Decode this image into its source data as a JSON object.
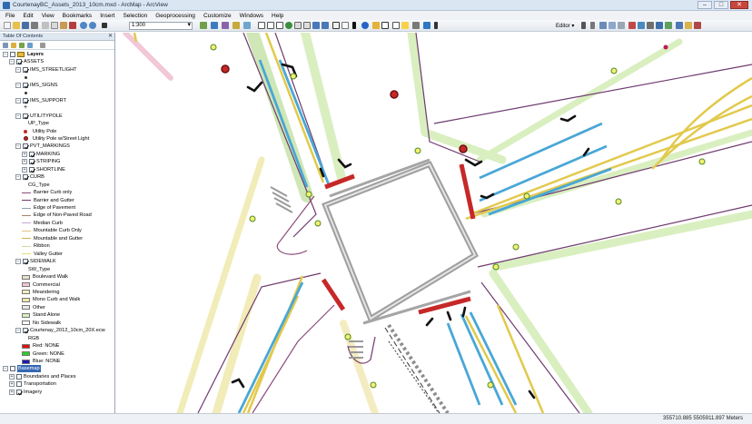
{
  "window": {
    "title": "CourtenayBC_Assets_2013_10cm.mxd - ArcMap - ArcView"
  },
  "menu": [
    "File",
    "Edit",
    "View",
    "Bookmarks",
    "Insert",
    "Selection",
    "Geoprocessing",
    "Customize",
    "Windows",
    "Help"
  ],
  "toolbar": {
    "scale": "1:300",
    "editor_label": "Editor ▾"
  },
  "toc": {
    "title": "Table Of Contents",
    "rows": [
      {
        "label": "Layers",
        "indent": 0,
        "exp": "−",
        "chk": false,
        "sym": "layers",
        "bold": true
      },
      {
        "label": "ASSETS",
        "indent": 1,
        "exp": "−",
        "chk": true
      },
      {
        "label": "IMS_STREETLIGHT",
        "indent": 2,
        "exp": "−",
        "chk": true
      },
      {
        "label": "",
        "indent": 3,
        "sym": "dot"
      },
      {
        "label": "IMS_SIGNS",
        "indent": 2,
        "exp": "−",
        "chk": true
      },
      {
        "label": "",
        "indent": 3,
        "sym": "smalldot"
      },
      {
        "label": "IMS_SUPPORT",
        "indent": 2,
        "exp": "−",
        "chk": true
      },
      {
        "label": "",
        "indent": 3,
        "sym": "plus"
      },
      {
        "label": "UTILITYPOLE",
        "indent": 2,
        "exp": "−",
        "chk": true
      },
      {
        "label": "UP_Type",
        "indent": 4
      },
      {
        "label": "Utility Pole",
        "indent": 3,
        "sym": "reddot"
      },
      {
        "label": "Utility Pole w/Street Light",
        "indent": 3,
        "sym": "redring"
      },
      {
        "label": "PVT_MARKINGS",
        "indent": 2,
        "exp": "−",
        "chk": true
      },
      {
        "label": "MARKING",
        "indent": 3,
        "exp": "+",
        "chk": true
      },
      {
        "label": "STRIPING",
        "indent": 3,
        "exp": "+",
        "chk": true
      },
      {
        "label": "SHORTLINE",
        "indent": 3,
        "exp": "+",
        "chk": true
      },
      {
        "label": "CURB",
        "indent": 2,
        "exp": "−",
        "chk": true
      },
      {
        "label": "CG_Type",
        "indent": 4
      },
      {
        "label": "Barrier Curb only",
        "indent": 3,
        "sym": "line:#8c4b7a"
      },
      {
        "label": "Barrier and Gutter",
        "indent": 3,
        "sym": "line:#6f3a70"
      },
      {
        "label": "Edge of Pavement",
        "indent": 3,
        "sym": "line:#9aa0a6"
      },
      {
        "label": "Edge of Non-Paved Road",
        "indent": 3,
        "sym": "line:#a0866a"
      },
      {
        "label": "Median Curb",
        "indent": 3,
        "sym": "line:#c2a8d8"
      },
      {
        "label": "Mountable Curb Only",
        "indent": 3,
        "sym": "line:#e3c27a"
      },
      {
        "label": "Mountable and Gutter",
        "indent": 3,
        "sym": "line:#d6b24c"
      },
      {
        "label": "Ribbon",
        "indent": 3,
        "sym": "line:#d8d4a4"
      },
      {
        "label": "Valley Gutter",
        "indent": 3,
        "sym": "line:#e4dc7e"
      },
      {
        "label": "SIDEWALK",
        "indent": 2,
        "exp": "−",
        "chk": true
      },
      {
        "label": "SW_Type",
        "indent": 4
      },
      {
        "label": "Boulevard Walk",
        "indent": 3,
        "sym": "box:#e9e3c6"
      },
      {
        "label": "Commercial",
        "indent": 3,
        "sym": "box:#f2c8d6"
      },
      {
        "label": "Meandering",
        "indent": 3,
        "sym": "box:#f4ecc1"
      },
      {
        "label": "Mono Curb and Walk",
        "indent": 3,
        "sym": "box:#efe8a4"
      },
      {
        "label": "Other",
        "indent": 3,
        "sym": "box:#e9e9e9"
      },
      {
        "label": "Stand Alone",
        "indent": 3,
        "sym": "box:#d9efc0"
      },
      {
        "label": "No Sidewalk",
        "indent": 3,
        "sym": "box:#ffffff"
      },
      {
        "label": "Courtenay_2012_10cm_20X.ecw",
        "indent": 2,
        "exp": "−",
        "chk": true
      },
      {
        "label": "RGB",
        "indent": 4
      },
      {
        "label": "Red:    NONE",
        "indent": 3,
        "sym": "box:#e01010"
      },
      {
        "label": "Green: NONE",
        "indent": 3,
        "sym": "box:#2ccd2c"
      },
      {
        "label": "Blue:   NONE",
        "indent": 3,
        "sym": "box:#1a1ab3"
      },
      {
        "label": "Basemap",
        "indent": 0,
        "exp": "−",
        "chk": false,
        "sel": true
      },
      {
        "label": "Boundaries and Places",
        "indent": 1,
        "exp": "+",
        "chk": false
      },
      {
        "label": "Transportation",
        "indent": 1,
        "exp": "+",
        "chk": false
      },
      {
        "label": "Imagery",
        "indent": 1,
        "exp": "+",
        "chk": true
      }
    ]
  },
  "status": {
    "coords": "355710.885  5505911.897 Meters"
  }
}
